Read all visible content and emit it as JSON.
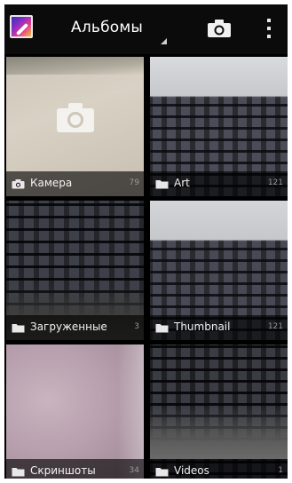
{
  "actionbar": {
    "title": "Альбомы",
    "app_icon": "gallery-app-icon",
    "camera_icon": "camera-icon",
    "overflow_icon": "overflow-menu-icon"
  },
  "albums": [
    {
      "label": "Камера",
      "count": "79",
      "icon": "camera-icon"
    },
    {
      "label": "Art",
      "count": "121",
      "icon": "folder-icon"
    },
    {
      "label": "Загруженные",
      "count": "3",
      "icon": "folder-icon"
    },
    {
      "label": "Thumbnail",
      "count": "121",
      "icon": "folder-icon"
    },
    {
      "label": "Скриншоты",
      "count": "34",
      "icon": "folder-icon"
    },
    {
      "label": "Videos",
      "count": "1",
      "icon": "folder-icon"
    }
  ],
  "colors": {
    "actionbar_bg": "#0b0b0b",
    "caption_bg": "#000000",
    "caption_text": "#f2f2f2",
    "count_text": "#9a9a9a"
  }
}
